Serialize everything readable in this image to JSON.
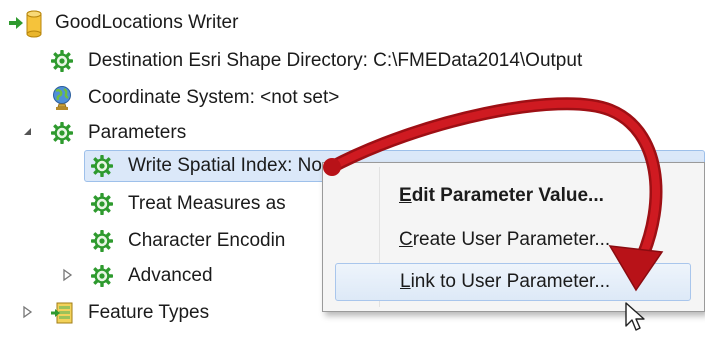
{
  "tree": {
    "writer": {
      "label": "GoodLocations Writer",
      "icon": "writer-db-icon"
    },
    "destination": {
      "label": "Destination Esri Shape Directory: C:\\FMEData2014\\Output",
      "icon": "gear-icon"
    },
    "coord_system": {
      "label": "Coordinate System: <not set>",
      "icon": "globe-icon"
    },
    "parameters": {
      "label": "Parameters",
      "icon": "gear-icon"
    },
    "write_spatial_index": {
      "label": "Write Spatial Index: No",
      "icon": "gear-icon"
    },
    "treat_measures": {
      "label": "Treat Measures as",
      "icon": "gear-icon"
    },
    "char_encoding": {
      "label": "Character Encodin",
      "icon": "gear-icon"
    },
    "advanced": {
      "label": "Advanced",
      "icon": "gear-icon"
    },
    "feature_types": {
      "label": "Feature Types",
      "icon": "feature-types-icon"
    }
  },
  "context_menu": {
    "edit": {
      "mnemonic": "E",
      "rest": "dit Parameter Value..."
    },
    "create": {
      "mnemonic": "C",
      "rest": "reate User Parameter..."
    },
    "link": {
      "mnemonic": "L",
      "rest": "ink to User Parameter..."
    }
  },
  "colors": {
    "selection": "#dbe8f9",
    "gear": "#2e9a2e",
    "arrow": "#b30f16"
  }
}
